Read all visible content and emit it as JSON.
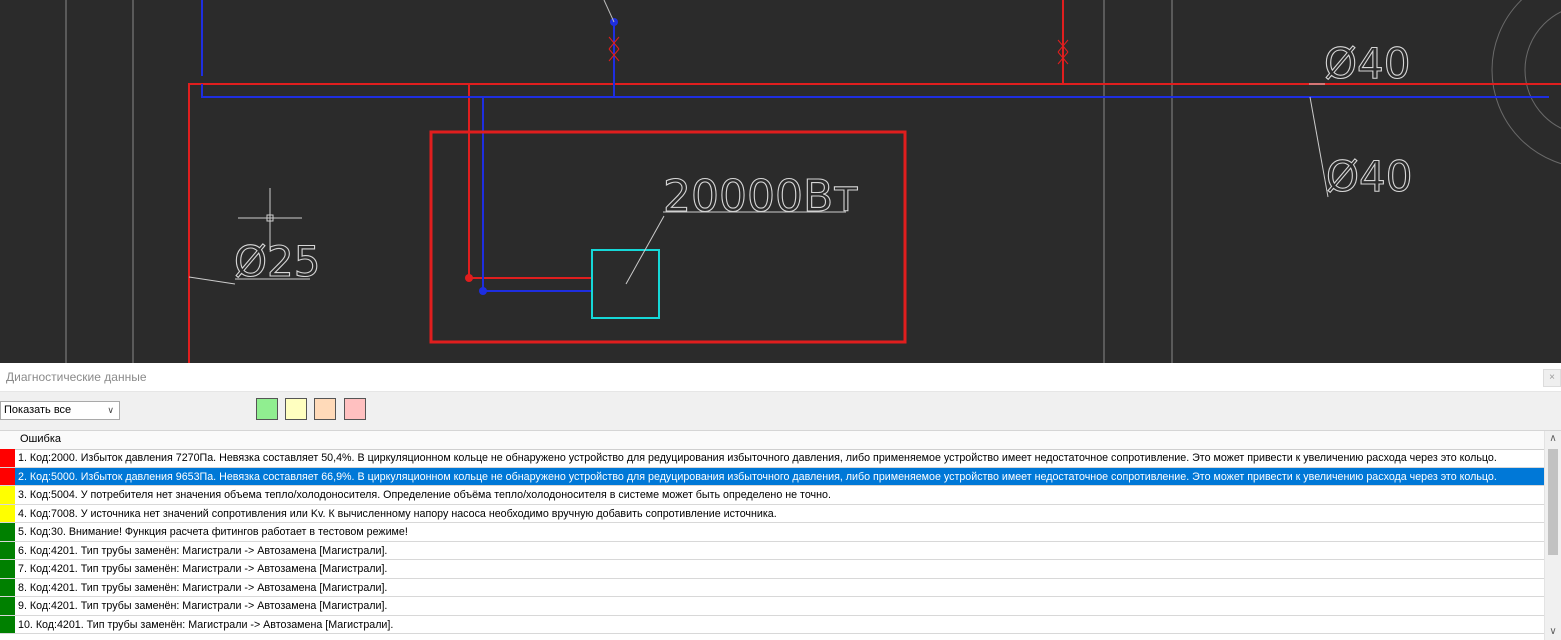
{
  "drawing": {
    "dim_1": "Ø40",
    "dim_2": "Ø40",
    "dim_3": "Ø25",
    "power_label": "20000Вт"
  },
  "panel": {
    "title": "Диагностические данные",
    "close_label": "×"
  },
  "toolbar": {
    "filter_selected": "Показать все",
    "legend_colors": [
      "#90ee90",
      "#ffffc0",
      "#ffdab9",
      "#ffc0c0"
    ]
  },
  "grid": {
    "column_header": "Ошибка",
    "rows": [
      {
        "severity": "#ff0000",
        "text": "1. Код:2000. Избыток давления 7270Па. Невязка составляет 50,4%. В циркуляционном кольце не обнаружено устройство для редуцирования избыточного давления, либо применяемое устройство имеет недостаточное сопротивление. Это может привести к увеличению расхода через это кольцо."
      },
      {
        "severity": "#ff0000",
        "text": "2. Код:5000. Избыток давления 9653Па. Невязка составляет 66,9%. В циркуляционном кольце не обнаружено устройство для редуцирования избыточного давления, либо применяемое устройство имеет недостаточное сопротивление. Это может привести к увеличению расхода через это кольцо."
      },
      {
        "severity": "#ffff00",
        "text": "3. Код:5004. У потребителя нет значения объема тепло/холодоносителя. Определение объёма тепло/холодоносителя в системе может быть определено не точно."
      },
      {
        "severity": "#ffff00",
        "text": "4. Код:7008. У источника нет значений сопротивления или Kv. К вычисленному напору насоса необходимо вручную добавить сопротивление источника."
      },
      {
        "severity": "#008000",
        "text": "5. Код:30. Внимание! Функция расчета фитингов работает в тестовом режиме!"
      },
      {
        "severity": "#008000",
        "text": "6. Код:4201. Тип трубы заменён: Магистрали -> Автозамена [Магистрали]."
      },
      {
        "severity": "#008000",
        "text": "7. Код:4201. Тип трубы заменён: Магистрали -> Автозамена [Магистрали]."
      },
      {
        "severity": "#008000",
        "text": "8. Код:4201. Тип трубы заменён: Магистрали -> Автозамена [Магистрали]."
      },
      {
        "severity": "#008000",
        "text": "9. Код:4201. Тип трубы заменён: Магистрали -> Автозамена [Магистрали]."
      },
      {
        "severity": "#008000",
        "text": "10. Код:4201. Тип трубы заменён: Магистрали -> Автозамена [Магистрали]."
      }
    ],
    "selected_index": 1
  }
}
